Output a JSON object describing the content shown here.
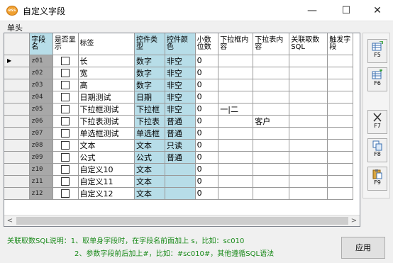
{
  "window": {
    "icon_text": "ess",
    "title": "自定义字段",
    "minimize_glyph": "—",
    "maximize_glyph": "☐",
    "close_glyph": "✕"
  },
  "section_label": "单头",
  "grid": {
    "row_indicator_glyph": "▶",
    "headers": {
      "field_name": "字段名",
      "show": "是否显示",
      "label": "标签",
      "control_type": "控件类型",
      "control_color": "控件颜色",
      "decimals": "小数位数",
      "dropdown_content": "下拉框内容",
      "droptable_content": "下拉表内容",
      "related_sql": "关联取数SQL",
      "trigger_field": "触发字段"
    },
    "rows": [
      {
        "code": "z01",
        "label": "长",
        "type": "数字",
        "color": "非空",
        "decimals": "0",
        "dropdown": "",
        "droptable": ""
      },
      {
        "code": "z02",
        "label": "宽",
        "type": "数字",
        "color": "非空",
        "decimals": "0",
        "dropdown": "",
        "droptable": ""
      },
      {
        "code": "z03",
        "label": "高",
        "type": "数字",
        "color": "非空",
        "decimals": "0",
        "dropdown": "",
        "droptable": ""
      },
      {
        "code": "z04",
        "label": "日期测试",
        "type": "日期",
        "color": "非空",
        "decimals": "0",
        "dropdown": "",
        "droptable": ""
      },
      {
        "code": "z05",
        "label": "下拉框测试",
        "type": "下拉框",
        "color": "非空",
        "decimals": "0",
        "dropdown": "一|二",
        "droptable": ""
      },
      {
        "code": "z06",
        "label": "下拉表测试",
        "type": "下拉表",
        "color": "普通",
        "decimals": "0",
        "dropdown": "",
        "droptable": "客户"
      },
      {
        "code": "z07",
        "label": "单选框测试",
        "type": "单选框",
        "color": "普通",
        "decimals": "0",
        "dropdown": "",
        "droptable": ""
      },
      {
        "code": "z08",
        "label": "文本",
        "type": "文本",
        "color": "只读",
        "decimals": "0",
        "dropdown": "",
        "droptable": ""
      },
      {
        "code": "z09",
        "label": "公式",
        "type": "公式",
        "color": "普通",
        "decimals": "0",
        "dropdown": "",
        "droptable": ""
      },
      {
        "code": "z10",
        "label": "自定义10",
        "type": "文本",
        "color": "",
        "decimals": "0",
        "dropdown": "",
        "droptable": ""
      },
      {
        "code": "z11",
        "label": "自定义11",
        "type": "文本",
        "color": "",
        "decimals": "0",
        "dropdown": "",
        "droptable": ""
      },
      {
        "code": "z12",
        "label": "自定义12",
        "type": "文本",
        "color": "",
        "decimals": "0",
        "dropdown": "",
        "droptable": ""
      }
    ]
  },
  "scrollbar": {
    "left_glyph": "<",
    "right_glyph": ">"
  },
  "side_buttons": [
    {
      "key": "F5",
      "icon": "add-row-icon"
    },
    {
      "key": "F6",
      "icon": "insert-row-icon"
    },
    {
      "key": "F7",
      "icon": "delete-icon"
    },
    {
      "key": "F8",
      "icon": "copy-icon"
    },
    {
      "key": "F9",
      "icon": "paste-icon"
    }
  ],
  "hints": {
    "line1": "关联取数SQL说明：1、取单身字段时，在字段名前面加上 s，比如：sc010",
    "line2": "2、参数字段前后加上#，比如：#sc010#，其他遵循SQL语法"
  },
  "apply_button": "应用",
  "colors": {
    "column_highlight": "#b7dde8",
    "code_cell": "#a8a8a8",
    "hint_text": "#1a8a1a"
  }
}
